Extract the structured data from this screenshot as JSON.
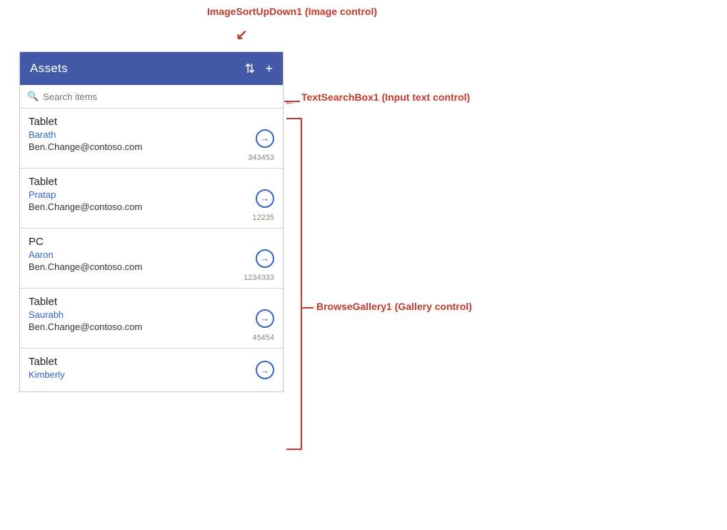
{
  "header": {
    "title": "Assets",
    "sort_icon": "⇅",
    "add_icon": "+"
  },
  "search": {
    "placeholder": "Search items",
    "icon": "🔍"
  },
  "items": [
    {
      "type": "Tablet",
      "name": "Barath",
      "email": "Ben.Change@contoso.com",
      "number": "343453"
    },
    {
      "type": "Tablet",
      "name": "Pratap",
      "email": "Ben.Change@contoso.com",
      "number": "12235"
    },
    {
      "type": "PC",
      "name": "Aaron",
      "email": "Ben.Change@contoso.com",
      "number": "1234333"
    },
    {
      "type": "Tablet",
      "name": "Saurabh",
      "email": "Ben.Change@contoso.com",
      "number": "45454"
    },
    {
      "type": "Tablet",
      "name": "Kimberly",
      "email": "",
      "number": ""
    }
  ],
  "annotations": {
    "sort_label": "ImageSortUpDown1 (Image control)",
    "search_label": "TextSearchBox1 (Input text control)",
    "gallery_label": "BrowseGallery1 (Gallery control)"
  }
}
